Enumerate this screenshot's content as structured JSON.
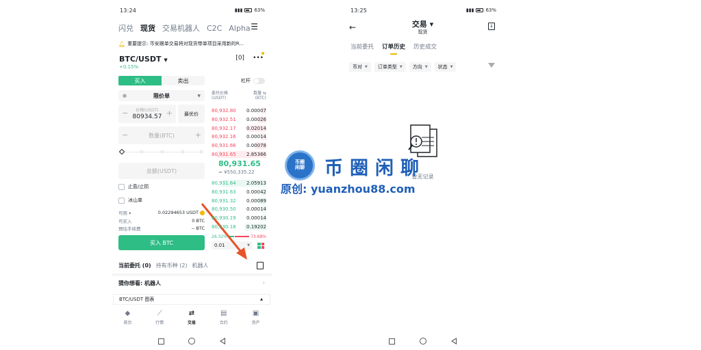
{
  "left": {
    "status": {
      "time": "13:24",
      "signal": "⁴ᴳ",
      "battery": "63%"
    },
    "top_tabs": [
      "闪兑",
      "现货",
      "交易机器人",
      "C2C",
      "Alpha"
    ],
    "notice": "重要提示: 币安跟单交易将对现货带单项目采用新的R...",
    "pair": "BTC/USDT",
    "pair_change": "+0.15%",
    "buy_label": "买入",
    "sell_label": "卖出",
    "leverage_label": "杠杆",
    "order_type": "限价单",
    "price_label": "价格(USDT)",
    "price_value": "80934.57",
    "best_price": "最优价",
    "amount_placeholder": "数量(BTC)",
    "total_placeholder": "总额(USDT)",
    "tpsl_label": "止盈/止损",
    "iceberg_label": "冰山单",
    "available_label": "可用",
    "available_value": "0.02294653 USDT",
    "can_buy_label": "可买入",
    "can_buy_value": "0 BTC",
    "fee_label": "预估手续费",
    "fee_value": "-- BTC",
    "buy_button": "买入 BTC",
    "ob_head_price": "委托价格\n(USDT)",
    "ob_head_price_1": "委托价格",
    "ob_head_price_2": "(USDT)",
    "ob_head_qty_1": "数量 ⇆",
    "ob_head_qty_2": "(BTC)",
    "asks": [
      {
        "p": "80,932.80",
        "q": "0.00007",
        "d": 0.08
      },
      {
        "p": "80,932.51",
        "q": "0.00026",
        "d": 0.15
      },
      {
        "p": "80,932.17",
        "q": "0.02014",
        "d": 0.35
      },
      {
        "p": "80,932.16",
        "q": "0.00014",
        "d": 0.1
      },
      {
        "p": "80,931.66",
        "q": "0.00078",
        "d": 0.2
      },
      {
        "p": "80,931.65",
        "q": "2.85366",
        "d": 0.9
      }
    ],
    "mid_price": "80,931.65",
    "mid_sub": "≈ ¥550,335.22",
    "bids": [
      {
        "p": "80,931.64",
        "q": "2.05913",
        "d": 0.8
      },
      {
        "p": "80,931.63",
        "q": "0.00042",
        "d": 0.1
      },
      {
        "p": "80,931.32",
        "q": "0.00089",
        "d": 0.15
      },
      {
        "p": "80,930.50",
        "q": "0.00014",
        "d": 0.08
      },
      {
        "p": "80,930.19",
        "q": "0.00014",
        "d": 0.08
      },
      {
        "p": "80,930.18",
        "q": "0.19202",
        "d": 0.4
      }
    ],
    "ratio_buy": "26.32%",
    "ratio_sell": "73.68%",
    "ratio_buy_frac": 0.2632,
    "precision": "0.01",
    "sub_tabs": [
      "当前委托 (0)",
      "持有币种 (2)",
      "机器人"
    ],
    "guess": "猜你想看: 机器人",
    "chart_row": "BTC/USDT 图表",
    "nav": [
      {
        "icon": "◆",
        "label": "首页"
      },
      {
        "icon": "⟋",
        "label": "行情"
      },
      {
        "icon": "⇄",
        "label": "交易"
      },
      {
        "icon": "▤",
        "label": "合约"
      },
      {
        "icon": "▣",
        "label": "资产"
      }
    ]
  },
  "right": {
    "status": {
      "time": "13:25",
      "battery": "63%"
    },
    "title": "交易 ▾",
    "subtitle": "现货",
    "tabs": [
      "当前委托",
      "订单历史",
      "历史成交"
    ],
    "filters": [
      "币对",
      "订单类型",
      "方向",
      "状态"
    ],
    "empty": "暂无记录"
  },
  "watermark": {
    "badge": "币圈\n闲聊",
    "badge_1": "币圈",
    "badge_2": "闲聊",
    "title": "币圈闲聊",
    "sub": "原创: yuanzhou88.com"
  },
  "colors": {
    "green": "#2ebd85",
    "red": "#f6465d",
    "yellow": "#f0b90b",
    "watermark_blue": "#1f5fb8"
  }
}
